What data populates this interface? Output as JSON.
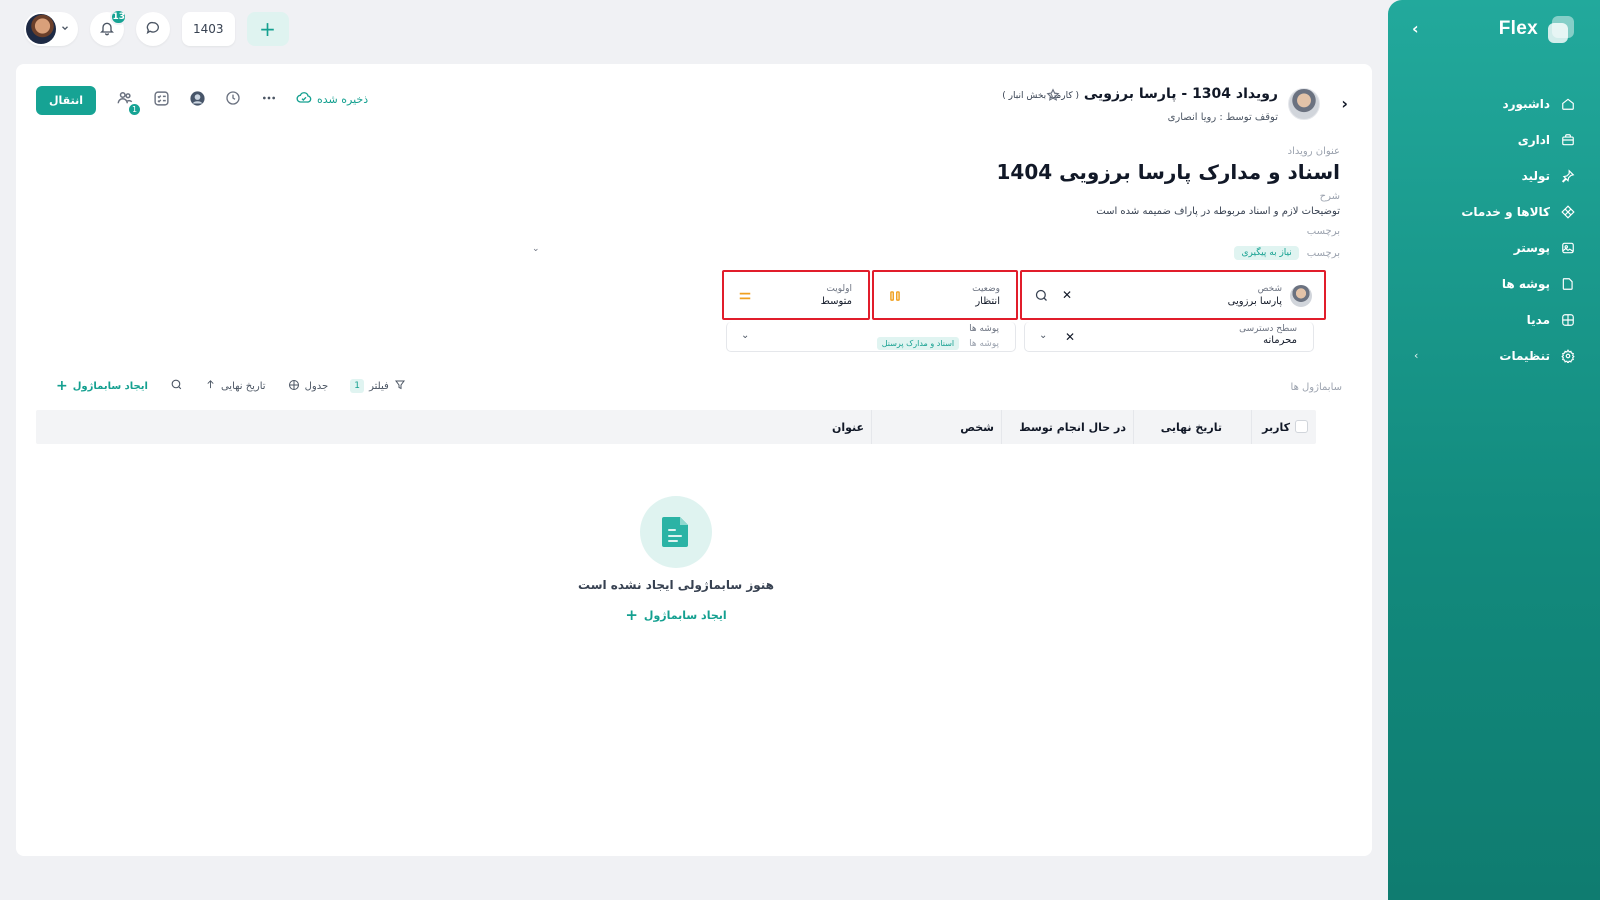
{
  "sidebar": {
    "brand": "Flex",
    "collapse_icon": "chevron-left-icon",
    "items": [
      {
        "label": "داشبورد",
        "icon": "home-icon"
      },
      {
        "label": "اداری",
        "icon": "briefcase-icon"
      },
      {
        "label": "تولید",
        "icon": "pin-icon"
      },
      {
        "label": "کالاها و خدمات",
        "icon": "diamond-icon"
      },
      {
        "label": "پوستر",
        "icon": "image-icon"
      },
      {
        "label": "پوشه ها",
        "icon": "folder-icon"
      },
      {
        "label": "مدیا",
        "icon": "globe-icon"
      },
      {
        "label": "تنظیمات",
        "icon": "gear-icon",
        "has_submenu": true
      }
    ]
  },
  "topbar": {
    "notifications_count": "13",
    "year": "1403"
  },
  "toolbar": {
    "transfer_label": "انتقال",
    "watchers_count": "1",
    "saved_label": "ذخیره شده"
  },
  "event": {
    "title": "رویداد 1304 - پارسا برزویی",
    "subtitle_tag": "( کارمند بخش انبار )",
    "status_line": "توقف توسط : رویا انصاری"
  },
  "details": {
    "title_label": "عنوان رویداد",
    "title_value": "اسناد و مدارک پارسا برزویی 1404",
    "desc_label": "شرح",
    "desc_value": "توضیحات لازم و اسناد مربوطه در پاراف ضمیمه شده است",
    "tag_label": "برچسب",
    "tag_chip": "نیاز به پیگیری",
    "tag_add": "برچسب"
  },
  "fields": {
    "person_label": "شخص",
    "person_value": "پارسا برزویی",
    "status_label": "وضعیت",
    "status_value": "انتظار",
    "priority_label": "اولویت",
    "priority_value": "متوسط",
    "access_label": "سطح دسترسی",
    "access_value": "محرمانه",
    "folders_label": "پوشه ها",
    "folders_chip": "اسناد و مدارک پرسنل",
    "folders_placeholder": "پوشه ها"
  },
  "subtasks": {
    "section_label": "سابماژول ها",
    "filter_label": "فیلتر",
    "filter_count": "1",
    "view_label": "جدول",
    "sort_label": "تاریخ نهایی",
    "create_label": "ایجاد سابماژول",
    "columns": [
      "کاربر",
      "تاریخ نهایی",
      "در حال انجام توسط",
      "شخص",
      "عنوان"
    ],
    "empty_text": "هنوز سابماژولی ایجاد نشده است",
    "empty_create": "ایجاد سابماژول"
  },
  "colors": {
    "accent": "#16a394",
    "highlight": "#e11d2b",
    "priority": "#f0a020"
  }
}
